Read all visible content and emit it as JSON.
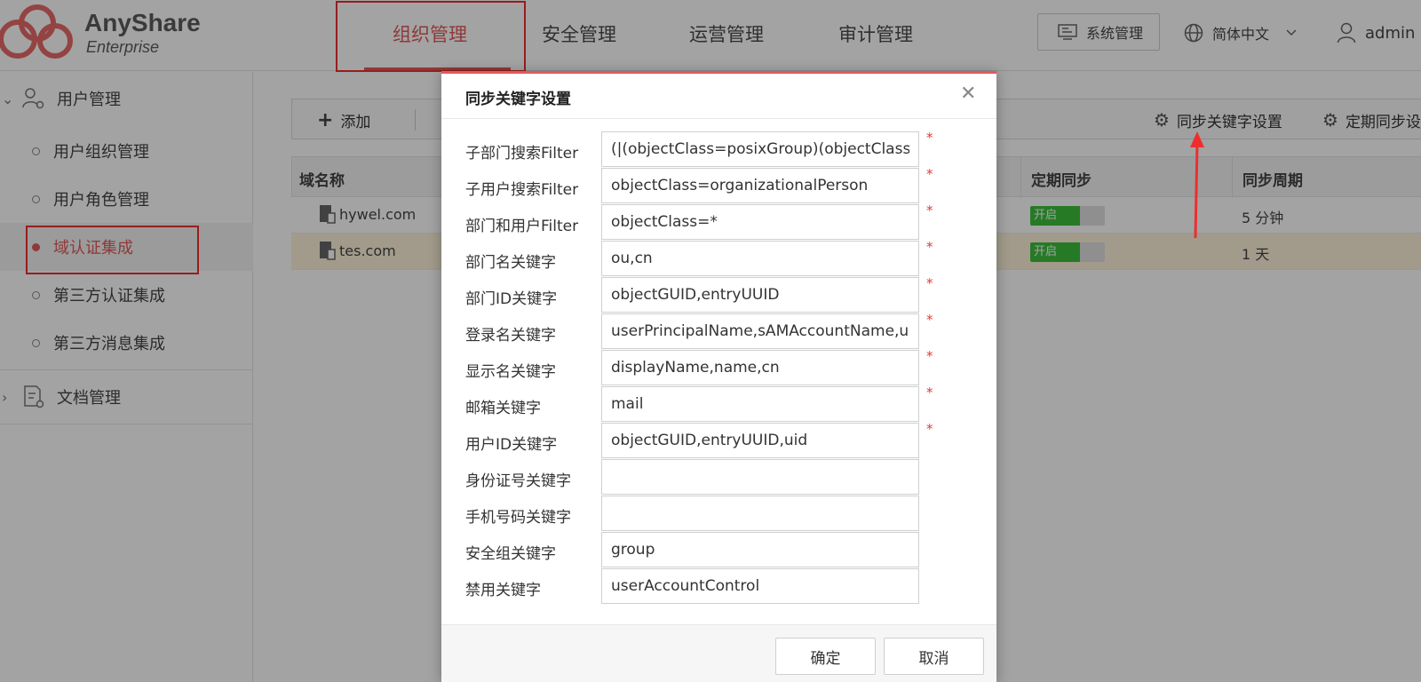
{
  "brand": {
    "name": "AnyShare",
    "edition": "Enterprise"
  },
  "nav": {
    "tabs": [
      {
        "label": "组织管理"
      },
      {
        "label": "安全管理"
      },
      {
        "label": "运营管理"
      },
      {
        "label": "审计管理"
      }
    ],
    "system_button": "系统管理",
    "language": "简体中文",
    "user": "admin"
  },
  "sidebar": {
    "group_user": "用户管理",
    "items": [
      {
        "label": "用户组织管理"
      },
      {
        "label": "用户角色管理"
      },
      {
        "label": "域认证集成"
      },
      {
        "label": "第三方认证集成"
      },
      {
        "label": "第三方消息集成"
      }
    ],
    "group_doc": "文档管理"
  },
  "toolbar": {
    "add_label": "添加",
    "sync_keyword_label": "同步关键字设置",
    "schedule_sync_label": "定期同步设"
  },
  "table": {
    "columns": [
      "域名称",
      "定期同步",
      "同步周期"
    ],
    "rows": [
      {
        "domain": "hywel.com",
        "sync": "开启",
        "period": "5 分钟"
      },
      {
        "domain": "tes.com",
        "sync": "开启",
        "period": "1 天"
      }
    ]
  },
  "modal": {
    "title": "同步关键字设置",
    "fields": [
      {
        "label": "子部门搜索Filter",
        "value": "(|(objectClass=posixGroup)(objectClass=",
        "required": true
      },
      {
        "label": "子用户搜索Filter",
        "value": "objectClass=organizationalPerson",
        "required": true
      },
      {
        "label": "部门和用户Filter",
        "value": "objectClass=*",
        "required": true
      },
      {
        "label": "部门名关键字",
        "value": "ou,cn",
        "required": true
      },
      {
        "label": "部门ID关键字",
        "value": "objectGUID,entryUUID",
        "required": true
      },
      {
        "label": "登录名关键字",
        "value": "userPrincipalName,sAMAccountName,u",
        "required": true
      },
      {
        "label": "显示名关键字",
        "value": "displayName,name,cn",
        "required": true
      },
      {
        "label": "邮箱关键字",
        "value": "mail",
        "required": true
      },
      {
        "label": "用户ID关键字",
        "value": "objectGUID,entryUUID,uid",
        "required": true
      },
      {
        "label": "身份证号关键字",
        "value": "",
        "required": false
      },
      {
        "label": "手机号码关键字",
        "value": "",
        "required": false
      },
      {
        "label": "安全组关键字",
        "value": "group",
        "required": false
      },
      {
        "label": "禁用关键字",
        "value": "userAccountControl",
        "required": false
      }
    ],
    "required_mark": "*",
    "confirm": "确定",
    "cancel": "取消"
  },
  "colors": {
    "accent": "#e05a5a",
    "highlight_box": "#ee2e2e",
    "toggle_on": "#3cbf3c",
    "selected_row": "#fdf3dc"
  }
}
